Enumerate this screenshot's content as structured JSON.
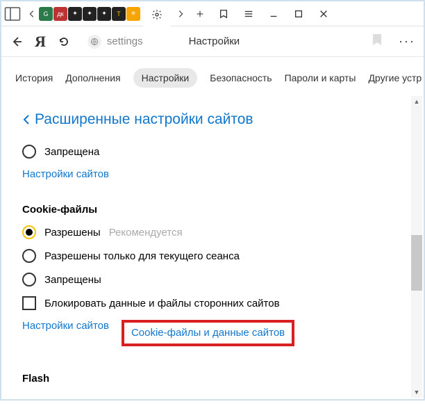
{
  "addressbar": {
    "url_text": "settings",
    "page_title": "Настройки"
  },
  "tabs": {
    "items": [
      "История",
      "Дополнения",
      "Настройки",
      "Безопасность",
      "Пароли и карты",
      "Другие устр"
    ],
    "active_index": 2
  },
  "section": {
    "back_title": "Расширенные настройки сайтов"
  },
  "block1": {
    "radio_label": "Запрещена",
    "site_settings": "Настройки сайтов"
  },
  "cookies": {
    "title": "Сookie-файлы",
    "opt_allowed": "Разрешены",
    "hint": "Рекомендуется",
    "opt_session": "Разрешены только для текущего сеанса",
    "opt_blocked": "Запрещены",
    "block_third": "Блокировать данные и файлы сторонних сайтов",
    "site_settings": "Настройки сайтов",
    "cookie_data": "Cookie-файлы и данные сайтов"
  },
  "flash": {
    "title": "Flash"
  }
}
